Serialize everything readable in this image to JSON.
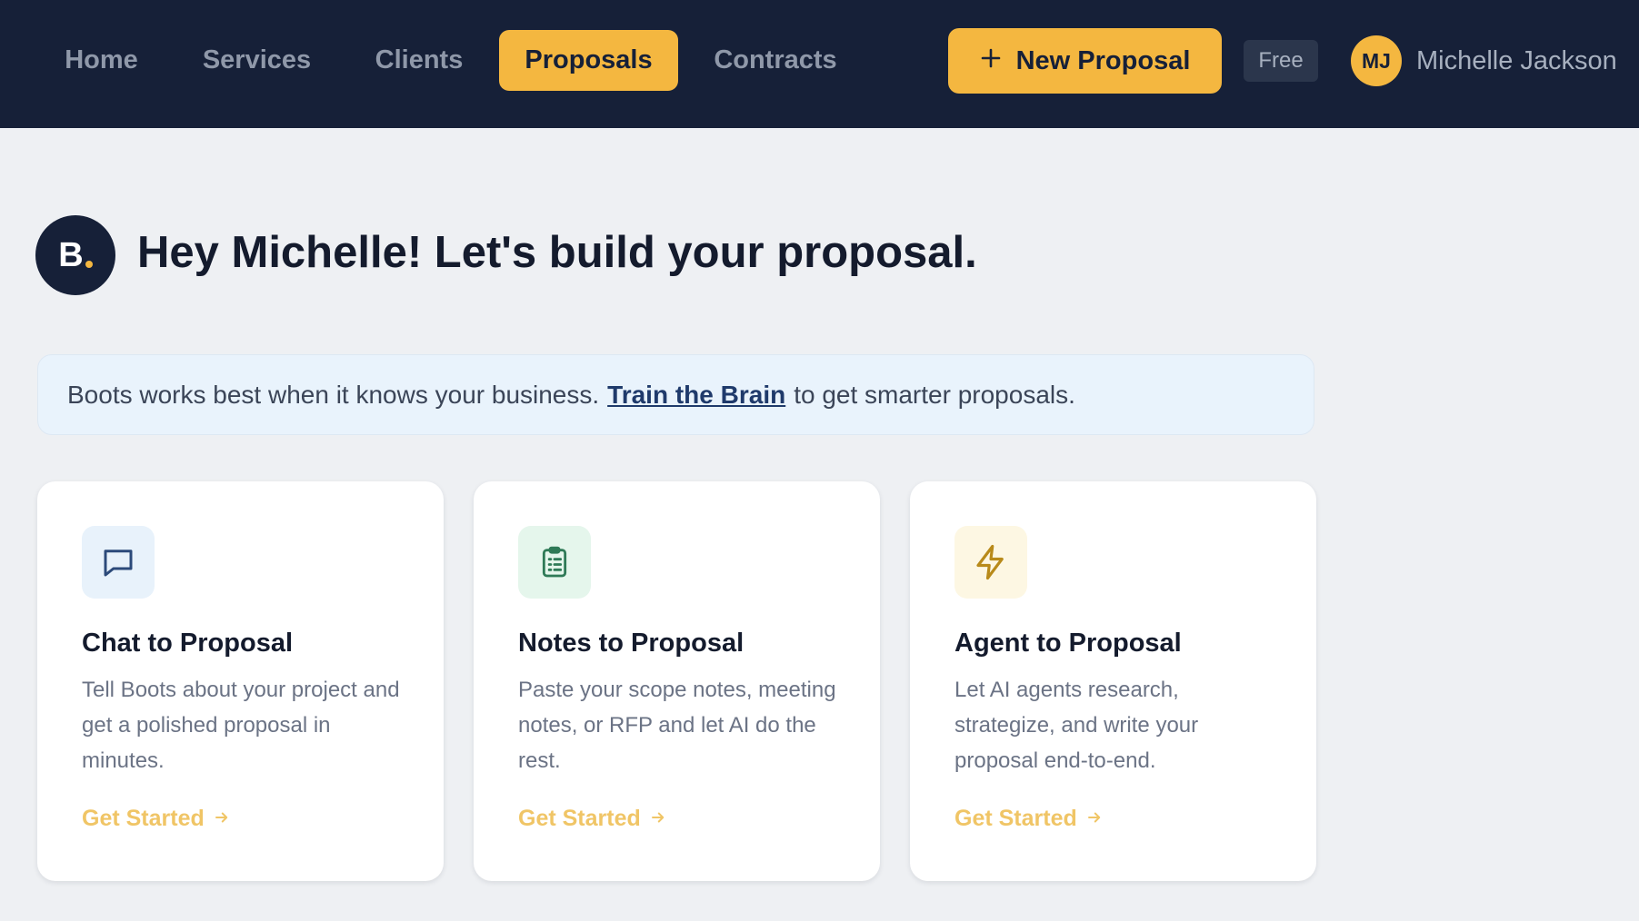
{
  "nav": {
    "items": [
      {
        "label": "Home"
      },
      {
        "label": "Services"
      },
      {
        "label": "Clients"
      },
      {
        "label": "Proposals",
        "active": true
      },
      {
        "label": "Contracts"
      }
    ],
    "new_proposal_label": "New Proposal",
    "plan_badge": "Free",
    "user": {
      "initials": "MJ",
      "name": "Michelle Jackson"
    }
  },
  "brand": {
    "logo_letter": "B"
  },
  "greeting": {
    "title": "Hey Michelle! Let's build your proposal."
  },
  "notice": {
    "before": "Boots works best when it knows your business.",
    "link": "Train the Brain",
    "after": "to get smarter proposals."
  },
  "cards": [
    {
      "icon": "chat-bubble-icon",
      "title": "Chat to Proposal",
      "description": "Tell Boots about your project and get a polished proposal in minutes.",
      "cta": "Get Started"
    },
    {
      "icon": "clipboard-list-icon",
      "title": "Notes to Proposal",
      "description": "Paste your scope notes, meeting notes, or RFP and let AI do the rest.",
      "cta": "Get Started"
    },
    {
      "icon": "lightning-bolt-icon",
      "title": "Agent to Proposal",
      "description": "Let AI agents research, strategize, and write your proposal end-to-end.",
      "cta": "Get Started"
    }
  ],
  "colors": {
    "topbar": "#162038",
    "accent": "#f4b740",
    "background": "#eef0f3",
    "notice_bg": "#e9f3fc",
    "cta": "#f0c566"
  }
}
